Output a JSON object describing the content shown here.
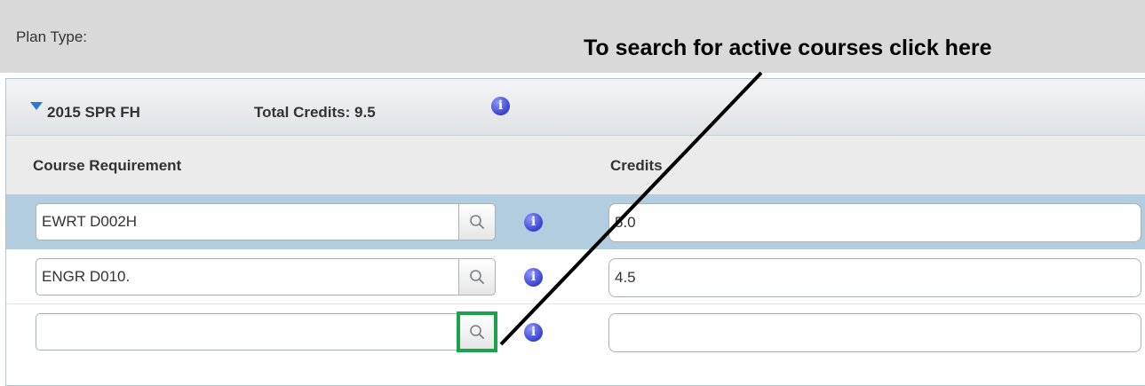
{
  "plan_type": {
    "label": "Plan Type:"
  },
  "callout": {
    "text": "To search for active courses click here"
  },
  "term": {
    "name": "2015 SPR FH",
    "total_credits": "Total Credits: 9.5",
    "toggle_icon": "triangle-down-icon",
    "info_icon": "info-icon"
  },
  "table": {
    "columns": {
      "course": "Course Requirement",
      "credits": "Credits"
    },
    "rows": [
      {
        "course": "EWRT D002H",
        "credits": "5.0",
        "search_icon": "magnifier-icon",
        "info_icon": "info-icon"
      },
      {
        "course": "ENGR D010.",
        "credits": "4.5",
        "search_icon": "magnifier-icon",
        "info_icon": "info-icon"
      },
      {
        "course": "",
        "credits": "",
        "search_icon": "magnifier-icon",
        "info_icon": "info-icon"
      }
    ]
  },
  "colors": {
    "selected_row": "#b2cddf",
    "highlight_box": "#1aa34a",
    "toggle": "#2a7bd0",
    "info": "#3a44c9"
  }
}
